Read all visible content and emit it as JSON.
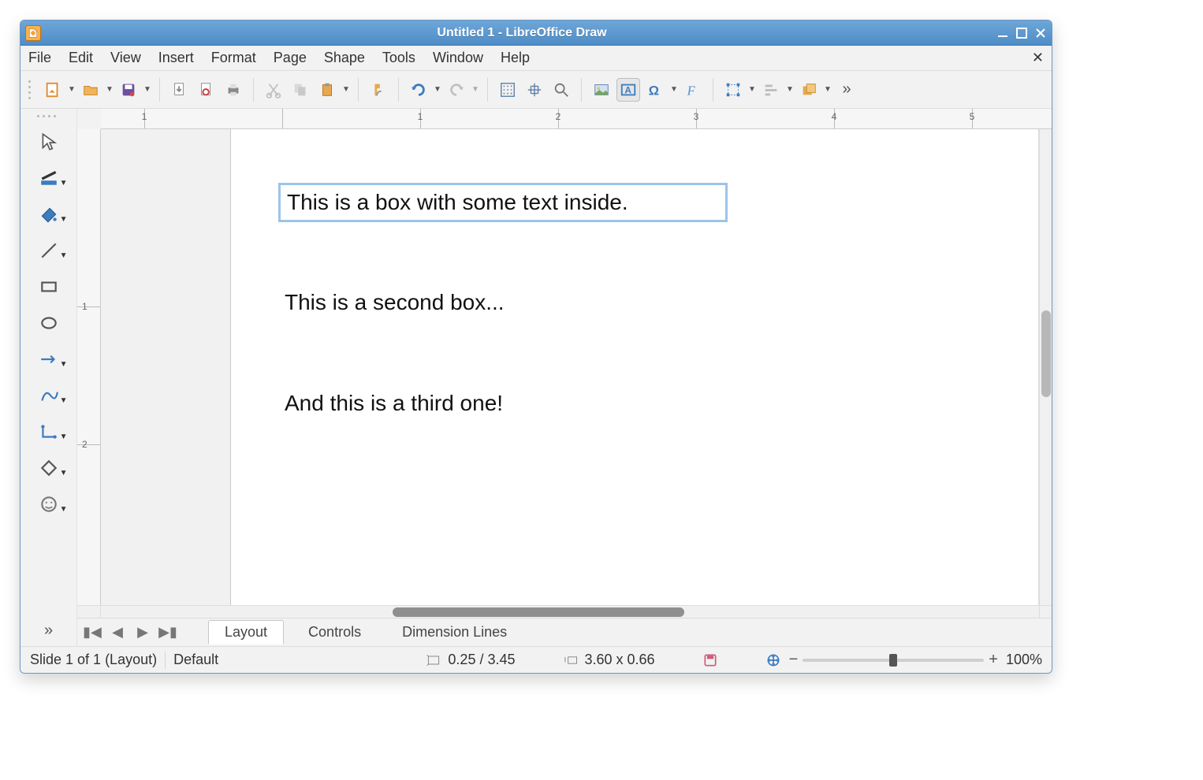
{
  "window": {
    "title": "Untitled 1 - LibreOffice Draw"
  },
  "menu": {
    "items": [
      "File",
      "Edit",
      "View",
      "Insert",
      "Format",
      "Page",
      "Shape",
      "Tools",
      "Window",
      "Help"
    ]
  },
  "toolbar": {
    "icons": [
      "new-document",
      "open-document",
      "save-document",
      "export-pdf",
      "print-preview",
      "print",
      "cut",
      "copy",
      "paste",
      "clone-formatting",
      "undo",
      "redo",
      "grid",
      "snap-grid",
      "zoom",
      "insert-image",
      "text-box",
      "special-character",
      "fontwork",
      "transform",
      "align",
      "arrange"
    ],
    "textbox_active": true
  },
  "left_tools": {
    "items": [
      "select",
      "line-color",
      "fill-color",
      "line",
      "rectangle",
      "ellipse",
      "arrow",
      "curve",
      "connector",
      "basic-shapes",
      "symbol-shapes"
    ]
  },
  "ruler": {
    "h_labels": [
      "1",
      "1",
      "2",
      "3",
      "4",
      "5"
    ],
    "v_labels": [
      "1",
      "2"
    ]
  },
  "canvas": {
    "boxes": [
      {
        "text": "This is a box with some text inside.",
        "selected": true
      },
      {
        "text": "This is a second box...",
        "selected": false
      },
      {
        "text": "And this is a third one!",
        "selected": false
      }
    ]
  },
  "tabs": {
    "items": [
      "Layout",
      "Controls",
      "Dimension Lines"
    ],
    "active_index": 0
  },
  "status": {
    "slide": "Slide 1 of 1 (Layout)",
    "master": "Default",
    "pos": "0.25 / 3.45",
    "size": "3.60 x 0.66",
    "modified": true,
    "zoom": "100%"
  }
}
